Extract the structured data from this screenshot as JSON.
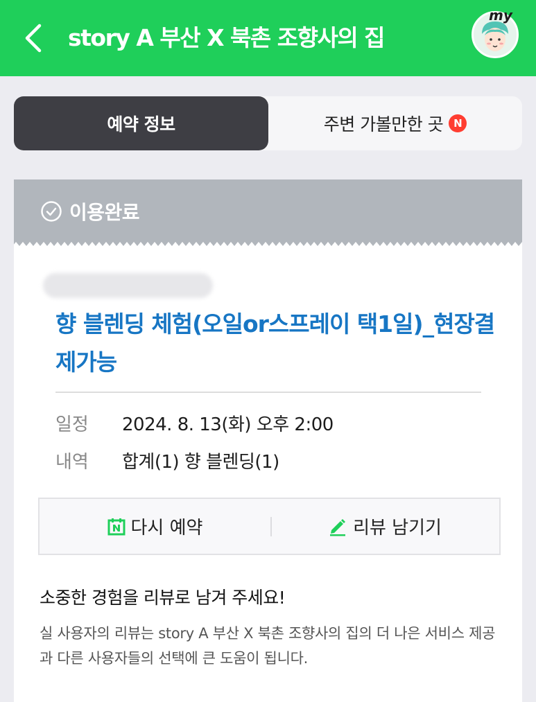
{
  "header": {
    "title": "story A 부산 X 북촌 조향사의 집",
    "avatar_tag": "my",
    "accent_color": "#1fcf5a"
  },
  "tabs": [
    {
      "label": "예약 정보",
      "active": true
    },
    {
      "label": "주변 가볼만한 곳",
      "active": false,
      "badge": "N"
    }
  ],
  "status": {
    "label": "이용완료",
    "icon": "check-circle-icon"
  },
  "booking": {
    "product_title": "향 블렌딩 체험(오일or스프레이 택1일)_현장결제가능",
    "schedule_label": "일정",
    "schedule_value": "2024. 8. 13(화) 오후 2:00",
    "detail_label": "내역",
    "detail_value": "합계(1) 향 블렌딩(1)"
  },
  "actions": {
    "rebook_label": "다시 예약",
    "review_label": "리뷰 남기기"
  },
  "review_prompt": {
    "heading": "소중한 경험을 리뷰로 남겨 주세요!",
    "description": "실 사용자의 리뷰는 story A 부산 X 북촌 조향사의 집의 더 나은 서비스 제공과 다른 사용자들의 선택에 큰 도움이 됩니다."
  }
}
